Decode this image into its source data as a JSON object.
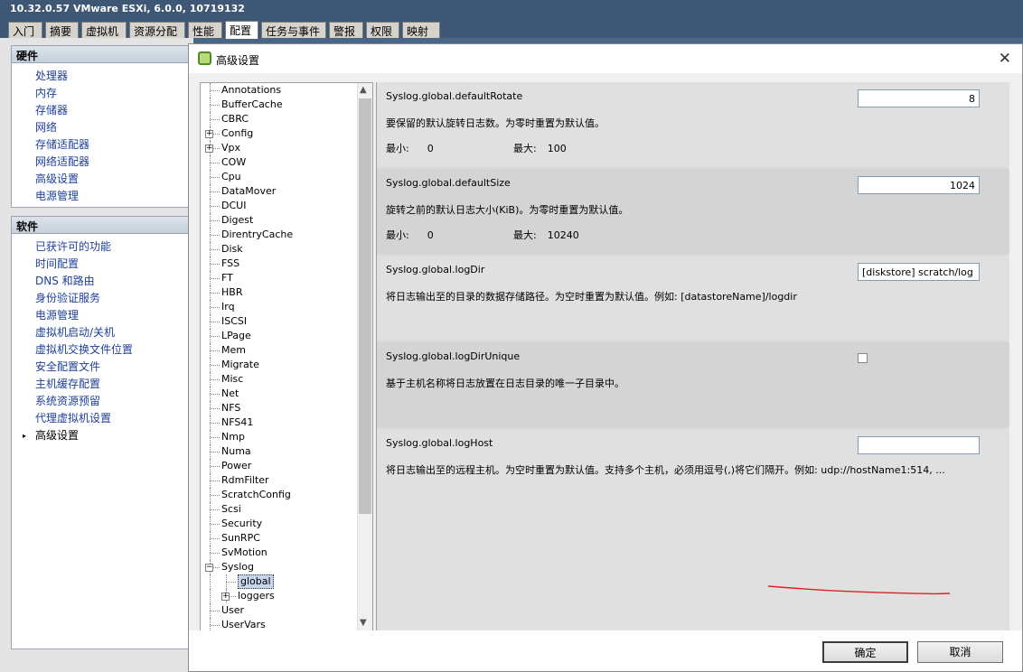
{
  "window_title": "10.32.0.57 VMware ESXi, 6.0.0, 10719132",
  "tabs": [
    "入门",
    "摘要",
    "虚拟机",
    "资源分配",
    "性能",
    "配置",
    "任务与事件",
    "警报",
    "权限",
    "映射"
  ],
  "hardware": {
    "header": "硬件",
    "items": [
      "处理器",
      "内存",
      "存储器",
      "网络",
      "存储适配器",
      "网络适配器",
      "高级设置",
      "电源管理"
    ]
  },
  "software": {
    "header": "软件",
    "items": [
      "已获许可的功能",
      "时间配置",
      "DNS 和路由",
      "身份验证服务",
      "电源管理",
      "虚拟机启动/关机",
      "虚拟机交换文件位置",
      "安全配置文件",
      "主机缓存配置",
      "系统资源预留",
      "代理虚拟机设置",
      "高级设置"
    ],
    "selected": "高级设置"
  },
  "dialog": {
    "title": "高级设置",
    "ok": "确定",
    "cancel": "取消"
  },
  "tree": [
    {
      "label": "Annotations"
    },
    {
      "label": "BufferCache"
    },
    {
      "label": "CBRC"
    },
    {
      "label": "Config",
      "expandable": true
    },
    {
      "label": "Vpx",
      "expandable": true
    },
    {
      "label": "COW"
    },
    {
      "label": "Cpu"
    },
    {
      "label": "DataMover"
    },
    {
      "label": "DCUI"
    },
    {
      "label": "Digest"
    },
    {
      "label": "DirentryCache"
    },
    {
      "label": "Disk"
    },
    {
      "label": "FSS"
    },
    {
      "label": "FT"
    },
    {
      "label": "HBR"
    },
    {
      "label": "Irq"
    },
    {
      "label": "ISCSI"
    },
    {
      "label": "LPage"
    },
    {
      "label": "Mem"
    },
    {
      "label": "Migrate"
    },
    {
      "label": "Misc"
    },
    {
      "label": "Net"
    },
    {
      "label": "NFS"
    },
    {
      "label": "NFS41"
    },
    {
      "label": "Nmp"
    },
    {
      "label": "Numa"
    },
    {
      "label": "Power"
    },
    {
      "label": "RdmFilter"
    },
    {
      "label": "ScratchConfig"
    },
    {
      "label": "Scsi"
    },
    {
      "label": "Security"
    },
    {
      "label": "SunRPC"
    },
    {
      "label": "SvMotion"
    },
    {
      "label": "Syslog",
      "expanded": true
    },
    {
      "label": "global",
      "child": true,
      "selected": true
    },
    {
      "label": "loggers",
      "child": true,
      "expandable": true
    },
    {
      "label": "User"
    },
    {
      "label": "UserVars"
    }
  ],
  "settings": [
    {
      "name": "Syslog.global.defaultRotate",
      "value": "8",
      "numeric": true,
      "desc": "要保留的默认旋转日志数。为零时重置为默认值。",
      "min_label": "最小:",
      "min": "0",
      "max_label": "最大:",
      "max": "100"
    },
    {
      "name": "Syslog.global.defaultSize",
      "value": "1024",
      "numeric": true,
      "desc": "旋转之前的默认日志大小(KiB)。为零时重置为默认值。",
      "min_label": "最小:",
      "min": "0",
      "max_label": "最大:",
      "max": "10240"
    },
    {
      "name": "Syslog.global.logDir",
      "value": "[diskstore] scratch/log",
      "desc": "将日志输出至的目录的数据存储路径。为空时重置为默认值。例如: [datastoreName]/logdir"
    },
    {
      "name": "Syslog.global.logDirUnique",
      "checkbox": true,
      "checked": false,
      "desc": "基于主机名称将日志放置在日志目录的唯一子目录中。"
    },
    {
      "name": "Syslog.global.logHost",
      "value": "",
      "desc": "将日志输出至的远程主机。为空时重置为默认值。支持多个主机，必须用逗号(,)将它们隔开。例如: udp://hostName1:514, ..."
    }
  ],
  "colors": {
    "accent_link": "#1f3f9a",
    "header_bar": "#3d5775",
    "annotation_line": "#e02020"
  }
}
